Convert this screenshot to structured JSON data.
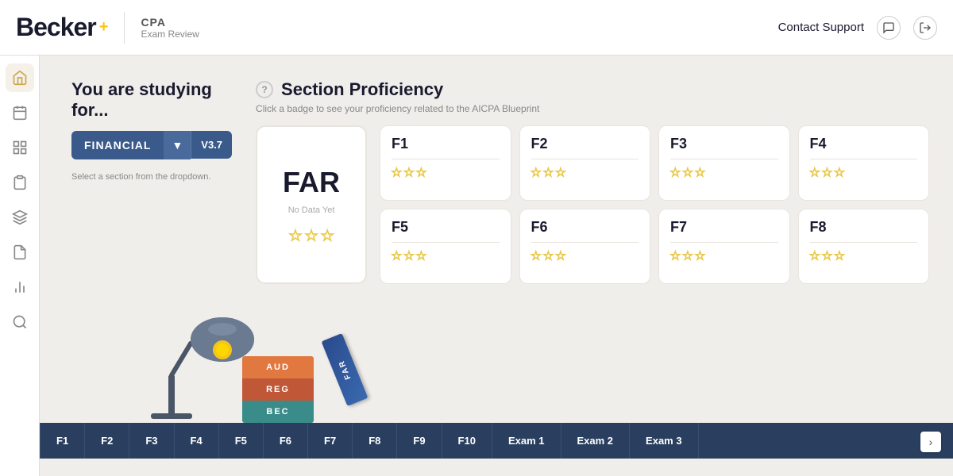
{
  "header": {
    "logo_text": "Becker",
    "logo_plus": "+",
    "product_name": "CPA",
    "product_sub": "Exam Review",
    "contact_support": "Contact Support"
  },
  "sidebar": {
    "items": [
      {
        "id": "home",
        "icon": "🏠",
        "active": true
      },
      {
        "id": "calendar",
        "icon": "📅",
        "active": false
      },
      {
        "id": "grid",
        "icon": "⊞",
        "active": false
      },
      {
        "id": "clipboard",
        "icon": "📋",
        "active": false
      },
      {
        "id": "layers",
        "icon": "⧉",
        "active": false
      },
      {
        "id": "document",
        "icon": "📄",
        "active": false
      },
      {
        "id": "chart",
        "icon": "📊",
        "active": false
      },
      {
        "id": "search",
        "icon": "🔍",
        "active": false
      }
    ]
  },
  "studying": {
    "label_line1": "You are studying",
    "label_line2": "for...",
    "dropdown_label": "FINANCIAL",
    "version": "V3.7",
    "hint": "Select a section from the dropdown."
  },
  "section_proficiency": {
    "title": "Section Proficiency",
    "subtitle": "Click a badge to see your proficiency related to the AICPA Blueprint",
    "far_label": "FAR",
    "far_no_data": "No Data Yet",
    "sections": [
      {
        "code": "F1"
      },
      {
        "code": "F2"
      },
      {
        "code": "F3"
      },
      {
        "code": "F4"
      },
      {
        "code": "F5"
      },
      {
        "code": "F6"
      },
      {
        "code": "F7"
      },
      {
        "code": "F8"
      }
    ]
  },
  "tabs": {
    "items": [
      "F1",
      "F2",
      "F3",
      "F4",
      "F5",
      "F6",
      "F7",
      "F8",
      "F9",
      "F10",
      "Exam 1",
      "Exam 2",
      "Exam 3"
    ]
  },
  "books": [
    {
      "label": "AUD",
      "color": "#e07840"
    },
    {
      "label": "REG",
      "color": "#c05030"
    },
    {
      "label": "BEC",
      "color": "#3a8c8a"
    }
  ],
  "colors": {
    "primary_dark": "#1a1a2e",
    "sidebar_bg": "#ffffff",
    "header_bg": "#ffffff",
    "content_bg": "#f0eeeb",
    "accent_blue": "#3a5a8c",
    "tab_bg": "#2a3f5f",
    "star_gold": "#e8c84a"
  }
}
